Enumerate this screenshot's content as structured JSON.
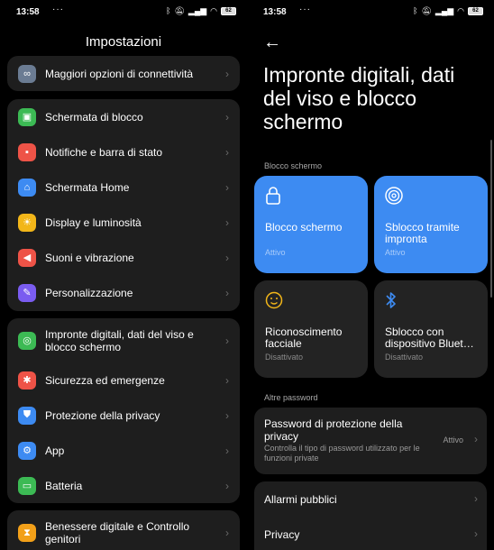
{
  "left": {
    "status": {
      "time": "13:58",
      "dots": "···",
      "battery": "62"
    },
    "title": "Impostazioni",
    "items": [
      {
        "label": "Maggiori opzioni di connettività",
        "icon": "link-icon",
        "color": "#6b7c93"
      },
      {
        "label": "Schermata di blocco",
        "icon": "lock-icon",
        "color": "#3cba54"
      },
      {
        "label": "Notifiche e barra di stato",
        "icon": "notification-icon",
        "color": "#ee5347"
      },
      {
        "label": "Schermata Home",
        "icon": "home-icon",
        "color": "#3d8bf2"
      },
      {
        "label": "Display e luminosità",
        "icon": "sun-icon",
        "color": "#f2b619"
      },
      {
        "label": "Suoni e vibrazione",
        "icon": "speaker-icon",
        "color": "#ee5347"
      },
      {
        "label": "Personalizzazione",
        "icon": "brush-icon",
        "color": "#7a5cf0"
      },
      {
        "label": "Impronte digitali, dati del viso e blocco schermo",
        "icon": "fingerprint-icon",
        "color": "#3cba54"
      },
      {
        "label": "Sicurezza ed emergenze",
        "icon": "emergency-icon",
        "color": "#ee5347"
      },
      {
        "label": "Protezione della privacy",
        "icon": "shield-icon",
        "color": "#3d8bf2"
      },
      {
        "label": "App",
        "icon": "gear-icon",
        "color": "#3d8bf2"
      },
      {
        "label": "Batteria",
        "icon": "battery-icon",
        "color": "#3cba54"
      },
      {
        "label": "Benessere digitale e Controllo genitori",
        "icon": "hourglass-icon",
        "color": "#f2a019"
      }
    ]
  },
  "right": {
    "status": {
      "time": "13:58",
      "dots": "···",
      "battery": "62"
    },
    "title": "Impronte digitali, dati del viso e blocco schermo",
    "section_lock": "Blocco schermo",
    "tiles": [
      {
        "label": "Blocco schermo",
        "status": "Attivo",
        "icon": "lock-icon"
      },
      {
        "label": "Sblocco tramite impronta",
        "status": "Attivo",
        "icon": "fingerprint-icon"
      },
      {
        "label": "Riconoscimento facciale",
        "status": "Disattivato",
        "icon": "face-icon"
      },
      {
        "label": "Sblocco con dispositivo Bluet…",
        "status": "Disattivato",
        "icon": "bluetooth-icon"
      }
    ],
    "section_other": "Altre password",
    "privacy_password": {
      "title": "Password di protezione della privacy",
      "subtitle": "Controlla il tipo di password utilizzato per le funzioni private",
      "value": "Attivo"
    },
    "public_alarms": "Allarmi pubblici",
    "privacy": "Privacy"
  },
  "colors": {
    "accent": "#3d8bf2",
    "card": "#1e1e1e",
    "background": "#000000"
  }
}
